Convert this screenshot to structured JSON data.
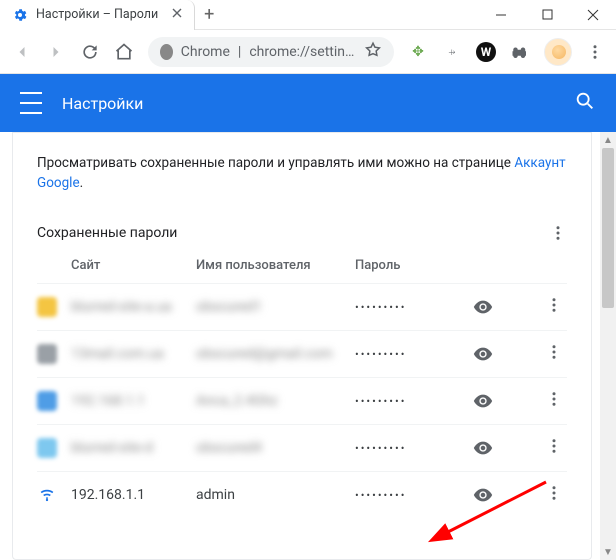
{
  "window": {
    "tab_title": "Настройки – Пароли",
    "new_tab_label": "+"
  },
  "addressbar": {
    "scheme_label": "Chrome",
    "url_display": "chrome://settings/p…"
  },
  "appbar": {
    "title": "Настройки"
  },
  "content": {
    "description_prefix": "Просматривать сохраненные пароли и управлять ими можно на странице ",
    "description_link": "Аккаунт Google",
    "description_suffix": ".",
    "section_title": "Сохраненные пароли",
    "columns": {
      "site": "Сайт",
      "user": "Имя пользователя",
      "password": "Пароль"
    },
    "rows": [
      {
        "site": "blurred-site-a.ua",
        "user": "obscured1",
        "pw": "•••••••••",
        "blurred": true,
        "fav_color": "#f4c542"
      },
      {
        "site": "13mail.com.ua",
        "user": "obscured@gmail.com",
        "pw": "•••••••••",
        "blurred": true,
        "fav_color": "#9aa0a6"
      },
      {
        "site": "192.168.1.1",
        "user": "Anca_2.4Ghz",
        "pw": "•••••••••",
        "blurred": true,
        "fav_color": "#4f9de6"
      },
      {
        "site": "blurred-site-d",
        "user": "obscured4",
        "pw": "•••••••••",
        "blurred": true,
        "fav_color": "#7ec8ef"
      },
      {
        "site": "192.168.1.1",
        "user": "admin",
        "pw": "•••••••••",
        "blurred": false,
        "fav_color": "#1a73e8"
      }
    ]
  },
  "icons": {
    "eye": "eye-icon",
    "kebab": "kebab-icon"
  }
}
